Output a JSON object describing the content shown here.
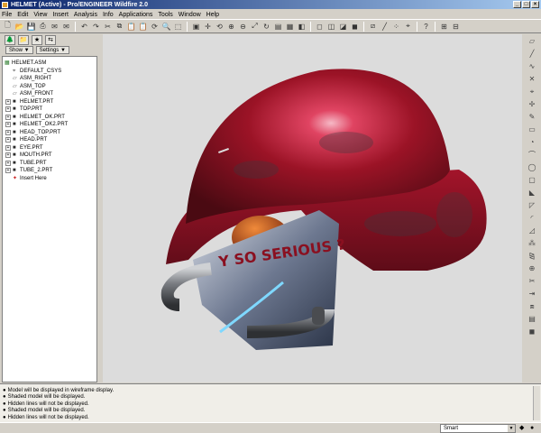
{
  "window": {
    "title": "HELMET (Active) - Pro/ENGINEER Wildfire 2.0"
  },
  "menu": [
    "File",
    "Edit",
    "View",
    "Insert",
    "Analysis",
    "Info",
    "Applications",
    "Tools",
    "Window",
    "Help"
  ],
  "left_panel": {
    "show_label": "Show ▼",
    "settings_label": "Settings ▼",
    "tree": [
      {
        "label": "HELMET.ASM",
        "icon": "assembly-icon",
        "expander": ""
      },
      {
        "label": "DEFAULT_CSYS",
        "icon": "csys-icon",
        "expander": ""
      },
      {
        "label": "ASM_RIGHT",
        "icon": "datum-plane-icon",
        "expander": ""
      },
      {
        "label": "ASM_TOP",
        "icon": "datum-plane-icon",
        "expander": ""
      },
      {
        "label": "ASM_FRONT",
        "icon": "datum-plane-icon",
        "expander": ""
      },
      {
        "label": "HELMET.PRT",
        "icon": "part-icon",
        "expander": "+"
      },
      {
        "label": "TOP.PRT",
        "icon": "part-icon",
        "expander": "+"
      },
      {
        "label": "HELMET_OK.PRT",
        "icon": "part-icon",
        "expander": "+"
      },
      {
        "label": "HELMET_OK2.PRT",
        "icon": "part-icon",
        "expander": "+"
      },
      {
        "label": "HEAD_TOP.PRT",
        "icon": "part-icon",
        "expander": "+"
      },
      {
        "label": "HEAD.PRT",
        "icon": "part-icon",
        "expander": "+"
      },
      {
        "label": "EYE.PRT",
        "icon": "part-icon",
        "expander": "+"
      },
      {
        "label": "MOUTH.PRT",
        "icon": "part-icon",
        "expander": "+"
      },
      {
        "label": "TUBE.PRT",
        "icon": "part-icon",
        "expander": "+"
      },
      {
        "label": "TUBE_2.PRT",
        "icon": "part-icon",
        "expander": "+"
      },
      {
        "label": "Insert Here",
        "icon": "insert-here-icon",
        "expander": ""
      }
    ]
  },
  "viewport": {
    "decal_text": "Y SO SERIOUS ?"
  },
  "messages": [
    "Model will be displayed in wireframe display.",
    "Shaded model will be displayed.",
    "Hidden lines will not be displayed.",
    "Shaded model will be displayed.",
    "Hidden lines will not be displayed."
  ],
  "status": {
    "filter_value": "Smart"
  },
  "colors": {
    "helmet_red": "#8a1020",
    "titlebar": "#0a246a",
    "tube_gray": "#5a5c60"
  }
}
